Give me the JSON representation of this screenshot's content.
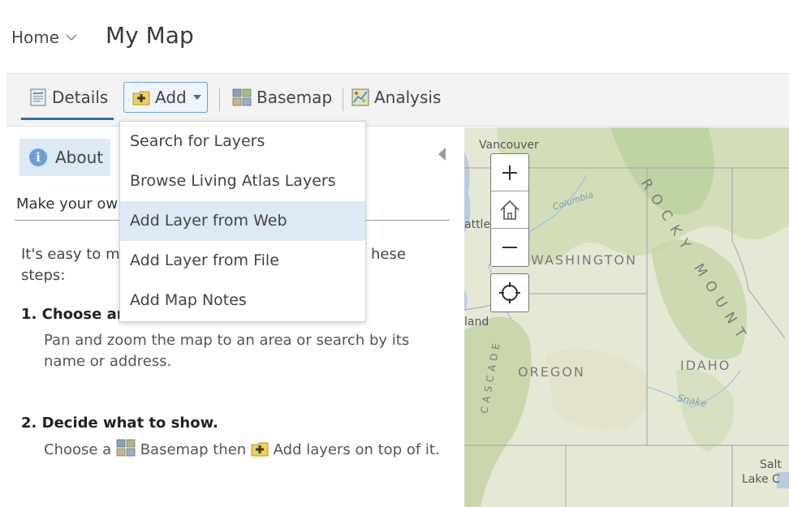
{
  "header": {
    "home_label": "Home",
    "map_title": "My Map"
  },
  "toolbar": {
    "details_label": "Details",
    "add_label": "Add",
    "basemap_label": "Basemap",
    "analysis_label": "Analysis"
  },
  "add_menu": {
    "items": [
      {
        "label": "Search for Layers",
        "active": false
      },
      {
        "label": "Browse Living Atlas Layers",
        "active": false
      },
      {
        "label": "Add Layer from Web",
        "active": true
      },
      {
        "label": "Add Layer from File",
        "active": false
      },
      {
        "label": "Add Map Notes",
        "active": false
      }
    ]
  },
  "panel": {
    "about_label": "About",
    "subtitle_visible": "Make your ow",
    "intro_visible": [
      "It's easy to m",
      "hese",
      "steps:"
    ],
    "step1_heading_visible": "1. Choose ar",
    "step1_body": "Pan and zoom the map to an area or search by its name or address.",
    "step2_heading": "2. Decide what to show.",
    "step2_body_a": "Choose a",
    "step2_body_b": "Basemap then",
    "step2_body_c": "Add layers on top of it."
  },
  "map": {
    "labels": {
      "vancouver": "Vancouver",
      "seattle": "attle",
      "portland": "land",
      "washington": "WASHINGTON",
      "oregon": "OREGON",
      "idaho": "IDAHO",
      "columbia": "Columbia",
      "snake": "Snake",
      "cascade": "CASCADE",
      "rocky": "ROCKY MOUNT",
      "salt_lake": "Salt",
      "salt_lake2": "Lake C"
    },
    "controls": {
      "zoom_in": "+",
      "zoom_out": "−"
    }
  },
  "colors": {
    "accent": "#2b6cb0",
    "menu_highlight": "#dde9f5",
    "toolbar_bg": "#f3f3f3"
  }
}
